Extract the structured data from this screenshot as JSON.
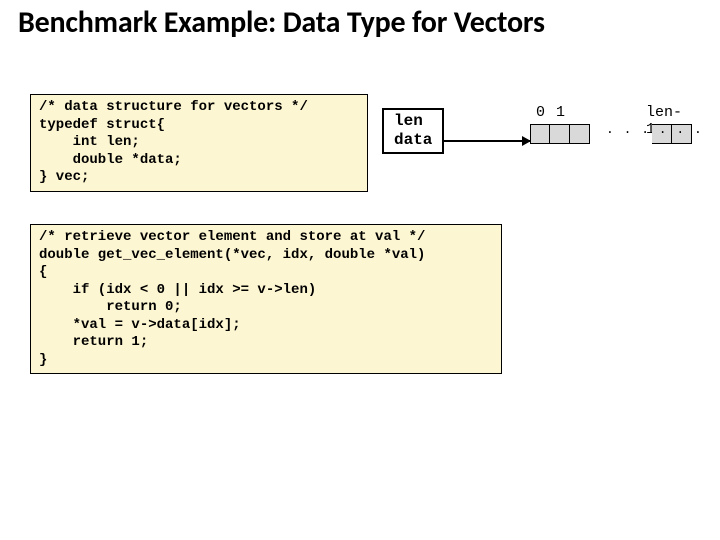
{
  "title": "Benchmark Example: Data Type for Vectors",
  "code1": "/* data structure for vectors */\ntypedef struct{\n    int len;\n    double *data;\n} vec;",
  "code2": "/* retrieve vector element and store at val */\ndouble get_vec_element(*vec, idx, double *val)\n{\n    if (idx < 0 || idx >= v->len)\n        return 0;\n    *val = v->data[idx];\n    return 1;\n}",
  "diagram": {
    "field1": "len",
    "field2": "data",
    "idx0": "0",
    "idx1": "1",
    "idxLast": "len-1",
    "dots": ". . . . . ."
  }
}
